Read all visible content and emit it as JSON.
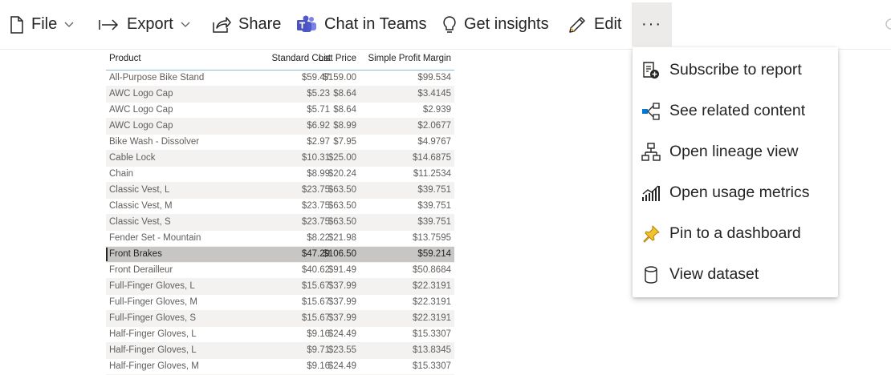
{
  "toolbar": {
    "file_label": "File",
    "export_label": "Export",
    "share_label": "Share",
    "teams_label": "Chat in Teams",
    "insights_label": "Get insights",
    "edit_label": "Edit",
    "more_label": "···"
  },
  "table": {
    "headers": [
      "Product",
      "Standard Cost",
      "List Price",
      "Simple Profit Margin"
    ],
    "selected_row_index": 11,
    "rows": [
      [
        "All-Purpose Bike Stand",
        "$59.47",
        "$159.00",
        "$99.534"
      ],
      [
        "AWC Logo Cap",
        "$5.23",
        "$8.64",
        "$3.4145"
      ],
      [
        "AWC Logo Cap",
        "$5.71",
        "$8.64",
        "$2.939"
      ],
      [
        "AWC Logo Cap",
        "$6.92",
        "$8.99",
        "$2.0677"
      ],
      [
        "Bike Wash - Dissolver",
        "$2.97",
        "$7.95",
        "$4.9767"
      ],
      [
        "Cable Lock",
        "$10.31",
        "$25.00",
        "$14.6875"
      ],
      [
        "Chain",
        "$8.99",
        "$20.24",
        "$11.2534"
      ],
      [
        "Classic Vest, L",
        "$23.75",
        "$63.50",
        "$39.751"
      ],
      [
        "Classic Vest, M",
        "$23.75",
        "$63.50",
        "$39.751"
      ],
      [
        "Classic Vest, S",
        "$23.75",
        "$63.50",
        "$39.751"
      ],
      [
        "Fender Set - Mountain",
        "$8.22",
        "$21.98",
        "$13.7595"
      ],
      [
        "Front Brakes",
        "$47.29",
        "$106.50",
        "$59.214"
      ],
      [
        "Front Derailleur",
        "$40.62",
        "$91.49",
        "$50.8684"
      ],
      [
        "Full-Finger Gloves, L",
        "$15.67",
        "$37.99",
        "$22.3191"
      ],
      [
        "Full-Finger Gloves, M",
        "$15.67",
        "$37.99",
        "$22.3191"
      ],
      [
        "Full-Finger Gloves, S",
        "$15.67",
        "$37.99",
        "$22.3191"
      ],
      [
        "Half-Finger Gloves, L",
        "$9.16",
        "$24.49",
        "$15.3307"
      ],
      [
        "Half-Finger Gloves, L",
        "$9.71",
        "$23.55",
        "$13.8345"
      ],
      [
        "Half-Finger Gloves, M",
        "$9.16",
        "$24.49",
        "$15.3307"
      ]
    ]
  },
  "menu": {
    "items": [
      {
        "label": "Subscribe to report",
        "icon": "subscribe-icon"
      },
      {
        "label": "See related content",
        "icon": "related-content-icon"
      },
      {
        "label": "Open lineage view",
        "icon": "lineage-icon"
      },
      {
        "label": "Open usage metrics",
        "icon": "usage-metrics-icon"
      },
      {
        "label": "Pin to a dashboard",
        "icon": "pin-icon"
      },
      {
        "label": "View dataset",
        "icon": "dataset-icon"
      }
    ]
  },
  "colors": {
    "accent_teams": "#5059c9",
    "pin": "#e8a317",
    "related_blue": "#0078d4",
    "selected_row": "#c8c6c4"
  }
}
